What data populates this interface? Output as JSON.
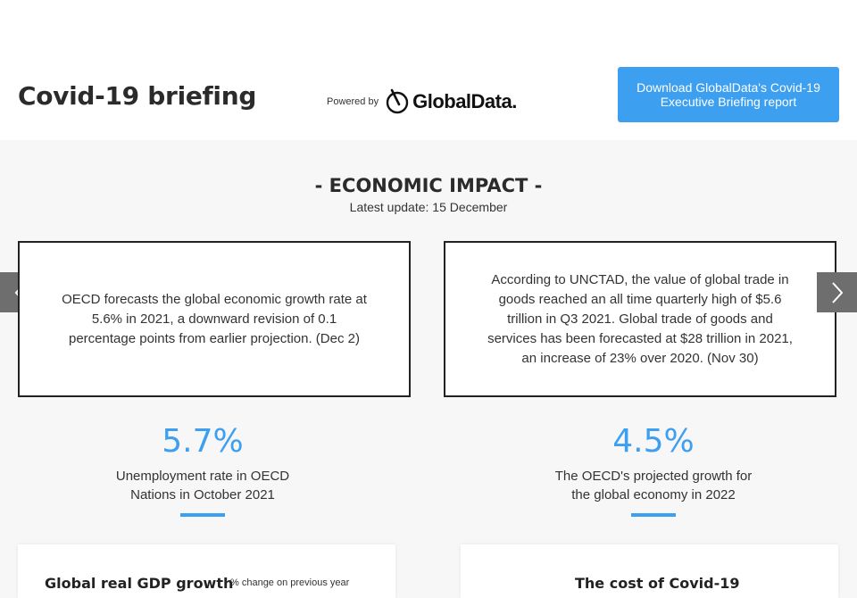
{
  "header": {
    "title": "Covid-19 briefing",
    "powered_by": "Powered by",
    "brand": "GlobalData.",
    "download_line1": "Download GlobalData's Covid-19",
    "download_line2": "Executive Briefing report"
  },
  "section": {
    "title": "- ECONOMIC IMPACT -",
    "subtitle": "Latest update: 15 December"
  },
  "carousel": {
    "cards": [
      {
        "text": "OECD forecasts the global economic growth rate at 5.6% in 2021, a downward revision of 0.1 percentage points from earlier projection. (Dec 2)"
      },
      {
        "text": "According to UNCTAD, the value of global trade in goods reached an all time quarterly high of $5.6 trillion in Q3 2021. Global trade of goods and services has been forecasted at $28 trillion in 2021, an increase of 23% over 2020. (Nov 30)"
      }
    ],
    "prev_icon": "chevron-left-icon",
    "next_icon": "chevron-right-icon"
  },
  "stats": [
    {
      "value": "5.7%",
      "caption_line1": "Unemployment rate in OECD",
      "caption_line2": "Nations in October 2021"
    },
    {
      "value": "4.5%",
      "caption_line1": "The OECD's projected growth for",
      "caption_line2": "the global economy in 2022"
    }
  ],
  "panels": [
    {
      "title": "Global real GDP growth",
      "note": "% change on previous year"
    },
    {
      "title": "The cost of Covid-19"
    }
  ],
  "colors": {
    "accent": "#3d9ff0",
    "arrow_bg": "#6e6e6e"
  }
}
